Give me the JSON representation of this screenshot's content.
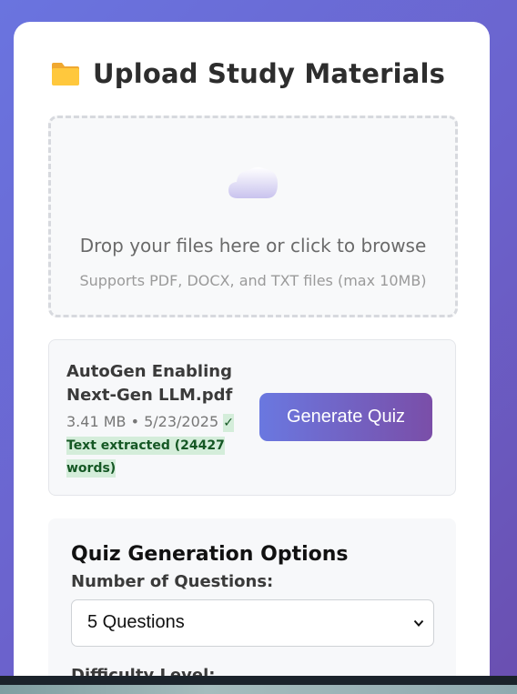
{
  "upload": {
    "title": "Upload Study Materials",
    "folder_icon": "folder-icon",
    "dropzone": {
      "icon": "cloud-icon",
      "main_text": "Drop your files here or click to browse",
      "sub_text": "Supports PDF, DOCX, and TXT files (max 10MB)"
    }
  },
  "file": {
    "name": "AutoGen Enabling Next-Gen LLM.pdf",
    "size_date": "3.41 MB • 5/23/2025",
    "status": "✓ Text extracted (24427 words)",
    "button_label": "Generate Quiz"
  },
  "options": {
    "title": "Quiz Generation Options",
    "questions_label": "Number of Questions:",
    "questions_selected": "5 Questions",
    "difficulty_label": "Difficulty Level:"
  },
  "colors": {
    "accent_start": "#6a78e0",
    "accent_end": "#7a4ea8",
    "success_bg": "#d4edda",
    "success_text": "#155724"
  }
}
